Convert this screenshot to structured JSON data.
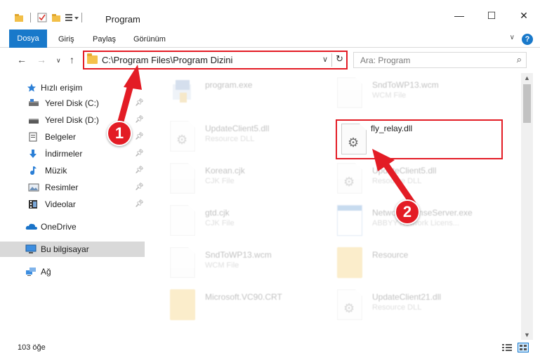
{
  "window": {
    "title": "Program",
    "controls": {
      "minimize": "—",
      "maximize": "☐",
      "close": "✕"
    }
  },
  "ribbon": {
    "tabs": [
      "Dosya",
      "Giriş",
      "Paylaş",
      "Görünüm"
    ],
    "help": "?"
  },
  "address": {
    "path": "C:\\Program Files\\Program Dizini",
    "search_placeholder": "Ara: Program"
  },
  "nav": {
    "quick_access": "Hızlı erişim",
    "items": [
      {
        "label": "Yerel Disk (C:)",
        "icon": "drive-icon"
      },
      {
        "label": "Yerel Disk (D:)",
        "icon": "drive-icon"
      },
      {
        "label": "Belgeler",
        "icon": "documents-icon"
      },
      {
        "label": "İndirmeler",
        "icon": "downloads-icon"
      },
      {
        "label": "Müzik",
        "icon": "music-icon"
      },
      {
        "label": "Resimler",
        "icon": "pictures-icon"
      },
      {
        "label": "Videolar",
        "icon": "videos-icon"
      }
    ],
    "onedrive": "OneDrive",
    "this_pc": "Bu bilgisayar",
    "network": "Ağ"
  },
  "files": {
    "left": [
      {
        "name": "program.exe",
        "type": ""
      },
      {
        "name": "UpdateClient5.dll",
        "type": "Resource DLL"
      },
      {
        "name": "Korean.cjk",
        "type": "CJK File"
      },
      {
        "name": "gtd.cjk",
        "type": "CJK File"
      },
      {
        "name": "SndToWP13.wcm",
        "type": "WCM File"
      },
      {
        "name": "Microsoft.VC90.CRT",
        "type": ""
      }
    ],
    "right": [
      {
        "name": "SndToWP13.wcm",
        "type": "WCM File"
      },
      {
        "name": "fly_relay.dll",
        "type": ""
      },
      {
        "name": "UpdateClient5.dll",
        "type": "Resource DLL"
      },
      {
        "name": "NetworkLicenseServer.exe",
        "type": "ABBYY Network Licens..."
      },
      {
        "name": "Resource",
        "type": ""
      },
      {
        "name": "UpdateClient21.dll",
        "type": "Resource DLL"
      }
    ]
  },
  "status": {
    "count": "103 öğe"
  },
  "annotations": {
    "step1": "1",
    "step2": "2",
    "color": "#e31c25"
  }
}
